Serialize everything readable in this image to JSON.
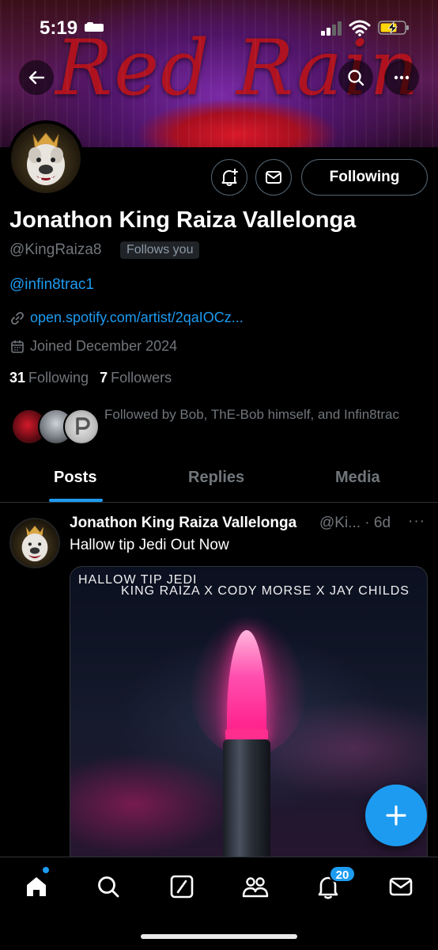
{
  "status_bar": {
    "time": "5:19"
  },
  "banner": {
    "title": "Red Rain"
  },
  "profile": {
    "name": "Jonathon King Raiza Vallelonga",
    "handle": "@KingRaiza8",
    "follows_you": "Follows you",
    "bio_mention": "@infin8trac1",
    "link": "open.spotify.com/artist/2qaIOCz...",
    "joined": "Joined December 2024",
    "following_count": "31",
    "following_label": "Following",
    "followers_count": "7",
    "followers_label": "Followers",
    "mutuals_text": "Followed by Bob, ThE-Bob himself, and Infin8trac",
    "follow_button": "Following"
  },
  "tabs": [
    {
      "label": "Posts",
      "active": true
    },
    {
      "label": "Replies",
      "active": false
    },
    {
      "label": "Media",
      "active": false
    }
  ],
  "post": {
    "author": "Jonathon King Raiza Vallelonga",
    "handle_time": "@Ki... · 6d",
    "more": "···",
    "text": "Hallow tip Jedi Out Now",
    "media_line1": "HALLOW TIP JEDI",
    "media_line2": "KING RAIZA X CODY MORSE X JAY CHILDS"
  },
  "nav": {
    "items": [
      "home-icon",
      "search-icon",
      "grok-icon",
      "communities-icon",
      "notifications-icon",
      "messages-icon"
    ],
    "notification_badge": "20"
  },
  "colors": {
    "accent": "#1d9bf0",
    "background": "#000000",
    "muted": "#71767b"
  }
}
